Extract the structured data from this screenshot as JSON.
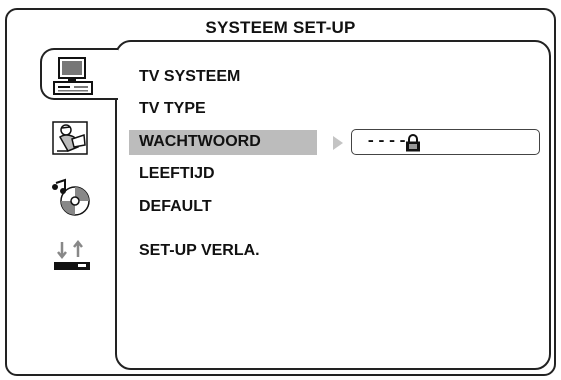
{
  "header": {
    "title": "SYSTEEM SET-UP"
  },
  "sidebar": {
    "icons": [
      {
        "name": "monitor-icon",
        "selected": true
      },
      {
        "name": "person-reading-icon",
        "selected": false
      },
      {
        "name": "music-disc-icon",
        "selected": false
      },
      {
        "name": "speaker-arrows-icon",
        "selected": false
      }
    ]
  },
  "menu": {
    "items": [
      {
        "label": "TV SYSTEEM"
      },
      {
        "label": "TV TYPE"
      },
      {
        "label": "WACHTWOORD"
      },
      {
        "label": "LEEFTIJD"
      },
      {
        "label": "DEFAULT"
      },
      {
        "label": "SET-UP VERLA."
      }
    ],
    "selected_index": 2
  },
  "password": {
    "value": "----"
  },
  "colors": {
    "highlight": "#bcbcbc",
    "border": "#222222",
    "arrow": "#c4c4c4"
  }
}
